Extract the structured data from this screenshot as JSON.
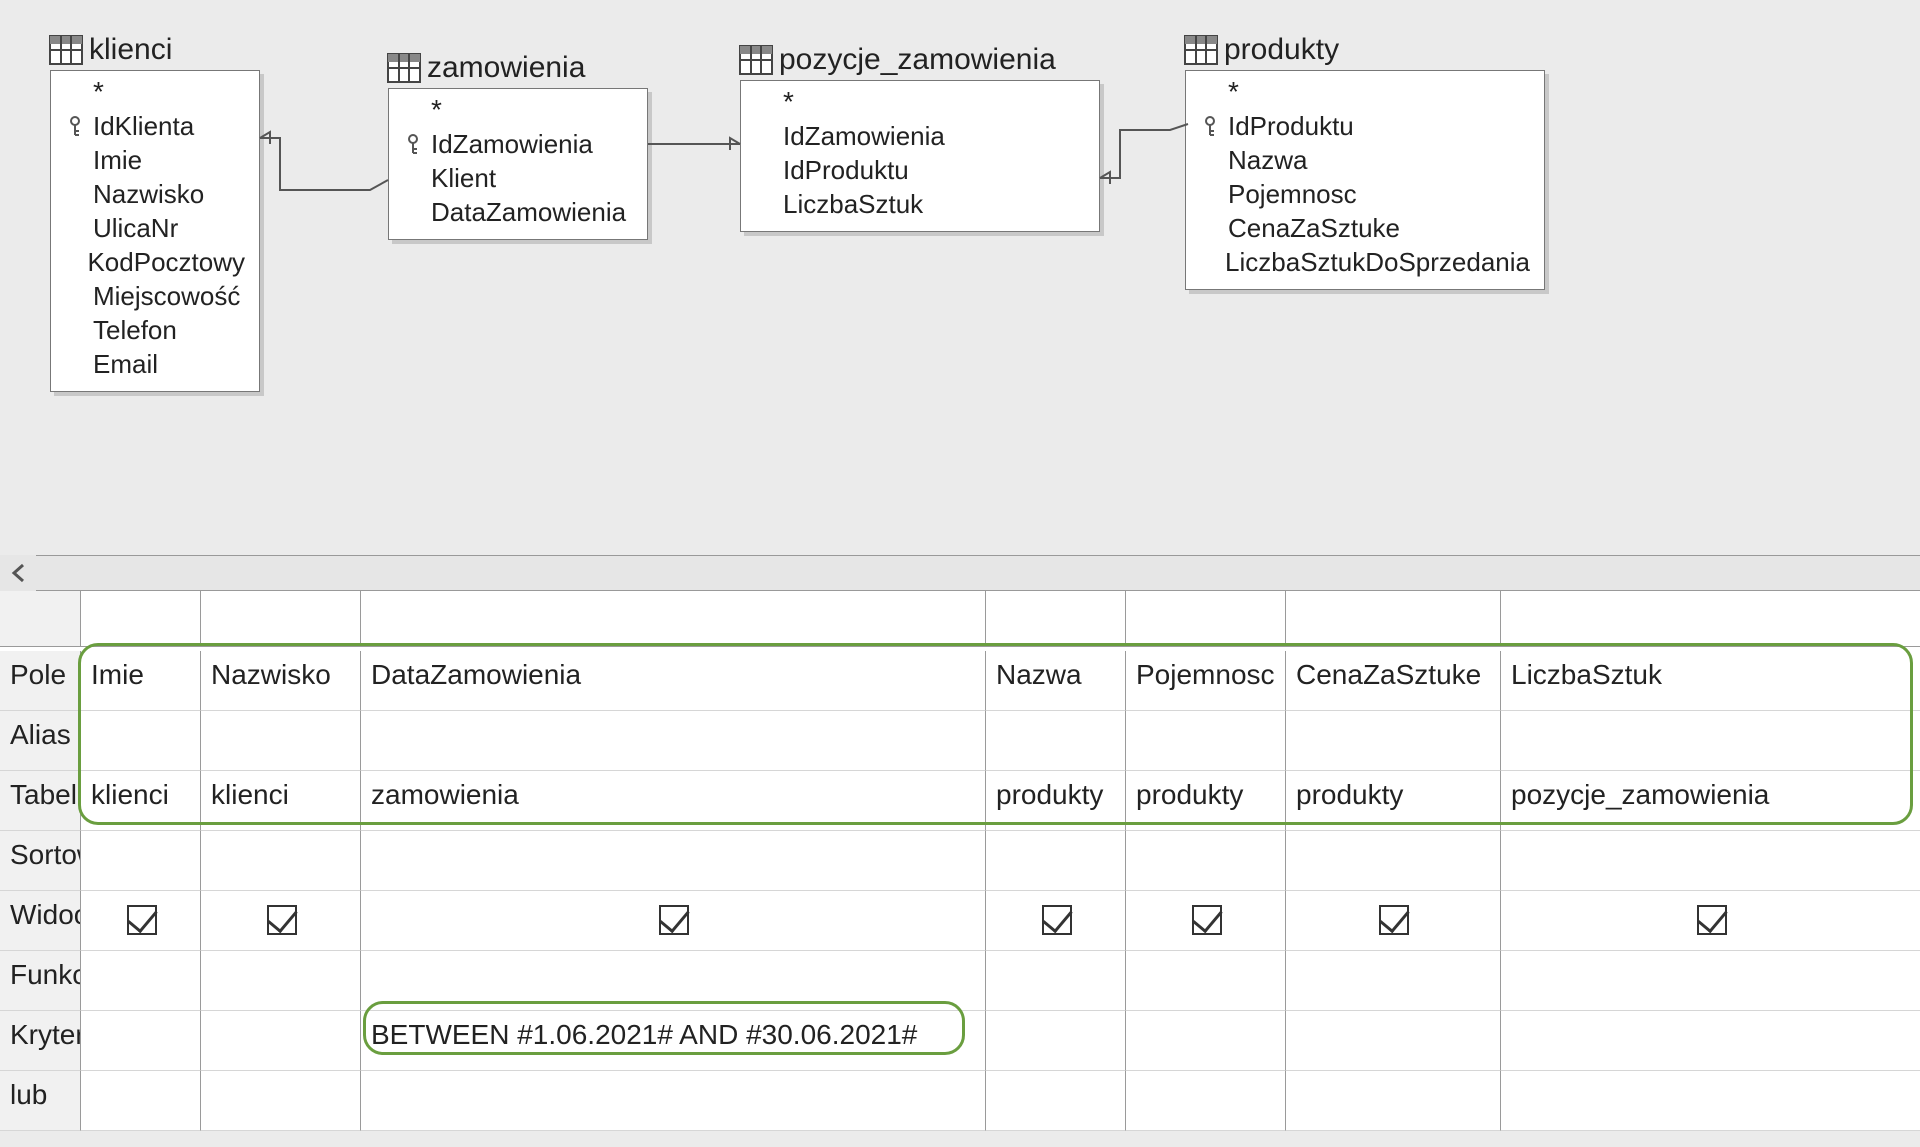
{
  "tables": {
    "klienci": {
      "title": "klienci",
      "fields": [
        "*",
        "IdKlienta",
        "Imie",
        "Nazwisko",
        "UlicaNr",
        "KodPocztowy",
        "Miejscowość",
        "Telefon",
        "Email"
      ],
      "keyIndex": 1
    },
    "zamowienia": {
      "title": "zamowienia",
      "fields": [
        "*",
        "IdZamowienia",
        "Klient",
        "DataZamowienia"
      ],
      "keyIndex": 1
    },
    "pozycje": {
      "title": "pozycje_zamowienia",
      "fields": [
        "*",
        "IdZamowienia",
        "IdProduktu",
        "LiczbaSztuk"
      ],
      "keyIndex": -1
    },
    "produkty": {
      "title": "produkty",
      "fields": [
        "*",
        "IdProduktu",
        "Nazwa",
        "Pojemnosc",
        "CenaZaSztuke",
        "LiczbaSztukDoSprzedania"
      ],
      "keyIndex": 1
    }
  },
  "gridRows": [
    "Pole",
    "Alias",
    "Tabela",
    "Sortowanie",
    "Widoczny",
    "Funkcja",
    "Kryterium",
    "lub"
  ],
  "columns": [
    {
      "pole": "Imie",
      "tabela": "klienci",
      "widoczny": true,
      "kryterium": ""
    },
    {
      "pole": "Nazwisko",
      "tabela": "klienci",
      "widoczny": true,
      "kryterium": ""
    },
    {
      "pole": "DataZamowienia",
      "tabela": "zamowienia",
      "widoczny": true,
      "kryterium": "BETWEEN #1.06.2021# AND #30.06.2021#"
    },
    {
      "pole": "Nazwa",
      "tabela": "produkty",
      "widoczny": true,
      "kryterium": ""
    },
    {
      "pole": "Pojemnosc",
      "tabela": "produkty",
      "widoczny": true,
      "kryterium": ""
    },
    {
      "pole": "CenaZaSztuke",
      "tabela": "produkty",
      "widoczny": true,
      "kryterium": ""
    },
    {
      "pole": "LiczbaSztuk",
      "tabela": "pozycje_zamowienia",
      "widoczny": true,
      "kryterium": ""
    }
  ]
}
